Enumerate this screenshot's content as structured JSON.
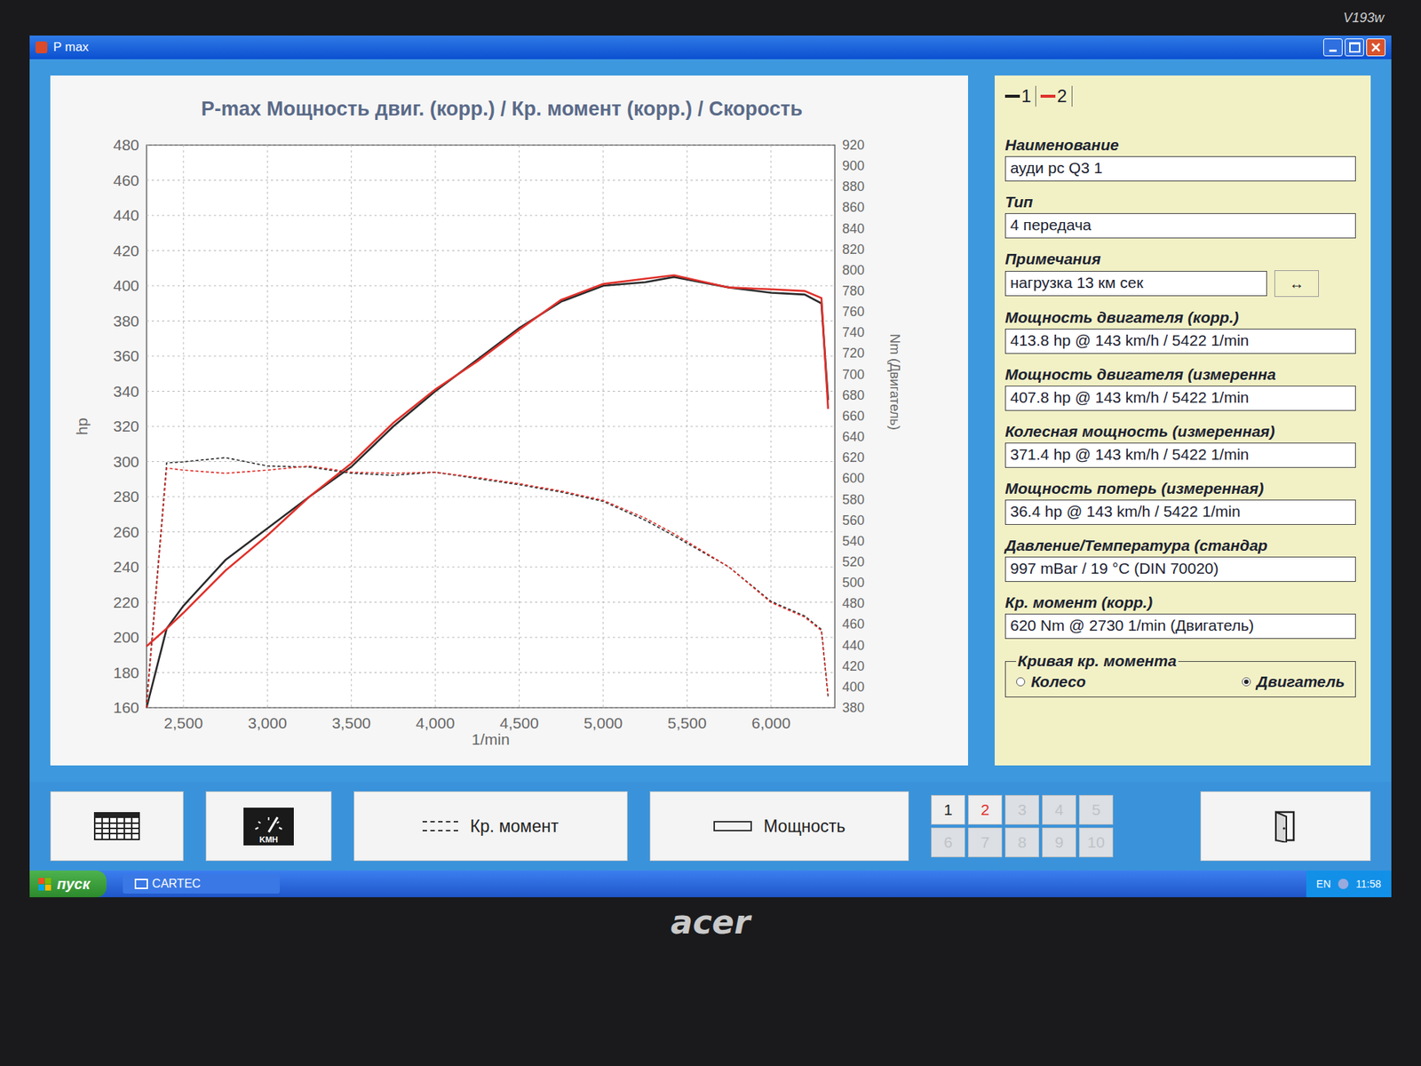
{
  "monitor": {
    "model": "V193w",
    "brand": "acer"
  },
  "window": {
    "title": "P max"
  },
  "chart": {
    "title": "P-max Мощность двиг. (корр.) / Кр. момент (корр.) / Скорость",
    "y_left": {
      "label": "hp",
      "ticks": [
        "160",
        "180",
        "200",
        "220",
        "240",
        "260",
        "280",
        "300",
        "320",
        "340",
        "360",
        "380",
        "400",
        "420",
        "440",
        "460",
        "480"
      ]
    },
    "y_right": {
      "label": "Nm (Двигатель)",
      "ticks": [
        "380",
        "400",
        "420",
        "440",
        "460",
        "480",
        "500",
        "520",
        "540",
        "560",
        "580",
        "600",
        "620",
        "640",
        "660",
        "680",
        "700",
        "720",
        "740",
        "760",
        "780",
        "800",
        "820",
        "840",
        "860",
        "880",
        "900",
        "920"
      ]
    },
    "x": {
      "label": "1/min",
      "ticks": [
        "2,500",
        "3,000",
        "3,500",
        "4,000",
        "4,500",
        "5,000",
        "5,500",
        "6,000"
      ]
    },
    "rpm": [
      2280,
      2400,
      2500,
      2750,
      3000,
      3250,
      3500,
      3750,
      4000,
      4250,
      4500,
      4750,
      5000,
      5250,
      5422,
      5750,
      6000,
      6200,
      6300,
      6340
    ],
    "series": [
      {
        "name": "1",
        "kind": "power",
        "color": "#2a2a2a",
        "values": [
          160,
          205,
          218,
          244,
          262,
          280,
          297,
          320,
          340,
          358,
          376,
          391,
          400,
          402,
          405,
          399,
          396,
          395,
          390,
          335
        ]
      },
      {
        "name": "2",
        "kind": "power",
        "color": "#e0302a",
        "values": [
          195,
          205,
          214,
          238,
          258,
          280,
          299,
          322,
          341,
          357,
          375,
          392,
          401,
          404,
          406,
          399,
          398,
          397,
          393,
          330
        ]
      },
      {
        "name": "1",
        "kind": "torque",
        "color": "#2a2a2a",
        "values": [
          385,
          615,
          616,
          620,
          612,
          611,
          605,
          603,
          606,
          600,
          594,
          587,
          578,
          560,
          545,
          515,
          482,
          468,
          455,
          390
        ]
      },
      {
        "name": "2",
        "kind": "torque",
        "color": "#e0302a",
        "values": [
          380,
          610,
          608,
          605,
          608,
          612,
          606,
          605,
          606,
          601,
          595,
          588,
          579,
          562,
          547,
          515,
          481,
          467,
          454,
          392
        ]
      }
    ]
  },
  "legend": [
    {
      "label": "1",
      "color": "#1e1e1e"
    },
    {
      "label": "2",
      "color": "#e0302a"
    }
  ],
  "fields": [
    {
      "label": "Наименование",
      "value": "ауди рс Q3  1",
      "button": ""
    },
    {
      "label": "Тип",
      "value": "4 передача",
      "button": ""
    },
    {
      "label": "Примечания",
      "value": "нагрузка 13 км сек",
      "button": "↔"
    },
    {
      "label": "Мощность двигателя (корр.)",
      "value": "413.8 hp @ 143 km/h / 5422 1/min",
      "button": ""
    },
    {
      "label": "Мощность двигателя (измеренна",
      "value": "407.8 hp @ 143 km/h / 5422 1/min",
      "button": ""
    },
    {
      "label": "Колесная мощность (измеренная)",
      "value": "371.4 hp @ 143 km/h / 5422 1/min",
      "button": ""
    },
    {
      "label": "Мощность потерь (измеренная)",
      "value": "36.4 hp @ 143 km/h / 5422 1/min",
      "button": ""
    },
    {
      "label": "Давление/Температура (стандар",
      "value": "997 mBar / 19 °C (DIN 70020)",
      "button": ""
    },
    {
      "label": "Кр. момент (корр.)",
      "value": "620 Nm @ 2730 1/min (Двигатель)",
      "button": ""
    }
  ],
  "torque_curve": {
    "label": "Кривая кр. момента",
    "options": [
      {
        "label": "Колесо",
        "selected": false
      },
      {
        "label": "Двигатель",
        "selected": true
      }
    ]
  },
  "toolbar": [
    {
      "kind": "table",
      "label": ""
    },
    {
      "kind": "gauge",
      "label": "KMH"
    },
    {
      "kind": "dashed",
      "label": "Кр. момент"
    },
    {
      "kind": "solid",
      "label": "Мощность"
    }
  ],
  "curve_slots": [
    {
      "label": "1",
      "enabled": true,
      "color": "#1e1e1e"
    },
    {
      "label": "2",
      "enabled": true,
      "color": "#e0302a"
    },
    {
      "label": "3",
      "enabled": false,
      "color": "#bfc3c8"
    },
    {
      "label": "4",
      "enabled": false,
      "color": "#bfc3c8"
    },
    {
      "label": "5",
      "enabled": false,
      "color": "#bfc3c8"
    },
    {
      "label": "6",
      "enabled": false,
      "color": "#bfc3c8"
    },
    {
      "label": "7",
      "enabled": false,
      "color": "#bfc3c8"
    },
    {
      "label": "8",
      "enabled": false,
      "color": "#bfc3c8"
    },
    {
      "label": "9",
      "enabled": false,
      "color": "#bfc3c8"
    },
    {
      "label": "10",
      "enabled": false,
      "color": "#bfc3c8"
    }
  ],
  "taskbar": {
    "start": "пуск",
    "app": "CARTEC",
    "lang": "EN",
    "time": "11:58"
  }
}
